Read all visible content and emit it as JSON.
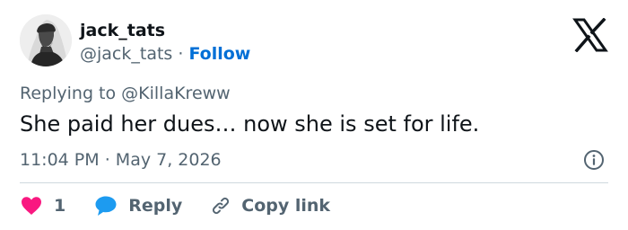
{
  "user": {
    "display_name": "jack_tats",
    "handle": "@jack_tats",
    "separator": "·",
    "follow_label": "Follow"
  },
  "tweet": {
    "replying_prefix": "Replying to ",
    "replying_to": "@KillaKreww",
    "text": "She paid her dues… now she is set for life.",
    "time": "11:04 PM",
    "date_separator": "·",
    "date": "May 7, 2026"
  },
  "actions": {
    "like_count": "1",
    "reply_label": "Reply",
    "copy_link_label": "Copy link"
  },
  "icons": {
    "logo": "x-logo-icon",
    "info": "info-icon",
    "like": "heart-icon",
    "reply": "speech-bubble-icon",
    "copy_link": "link-icon"
  },
  "colors": {
    "text": "#0f1419",
    "secondary": "#536471",
    "follow": "#006fd6",
    "like": "#f91880",
    "reply": "#1d9bf0",
    "divider": "#cfd9de"
  }
}
